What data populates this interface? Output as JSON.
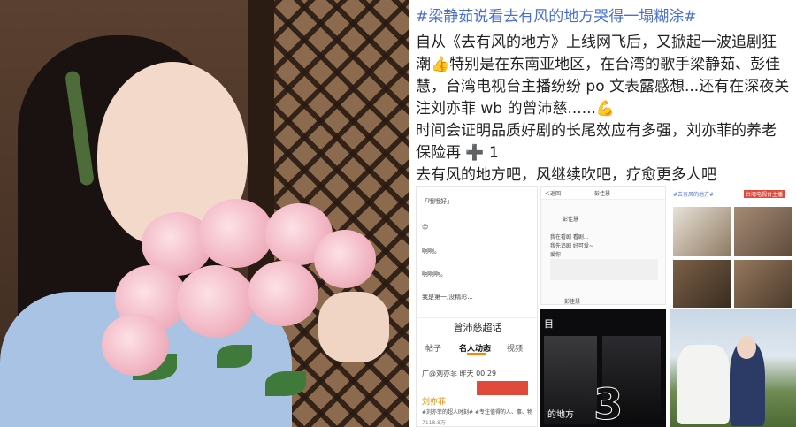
{
  "post": {
    "hashtag": "#梁静茹说看去有风的地方哭得一塌糊涂#",
    "lines": [
      "自从《去有风的地方》上线网飞后，又掀起一波追剧狂",
      "潮👍特别是在东南亚地区，在台湾的歌手梁静茹、彭佳",
      "慧，台湾电视台主播纷纷 po 文表露感想...还有在深夜关",
      "注刘亦菲 wb 的曾沛慈......💪",
      "时间会证明品质好剧的长尾效应有多强，刘亦菲的养老",
      "保险再 ➕ 1",
      "去有风的地方吧，风继续吹吧，疗愈更多人吧"
    ]
  },
  "screenshot_left": {
    "lines": [
      "「哦哦好」",
      "😊",
      "啊啊。",
      "啊啊啊。",
      "我是第一,没精彩..."
    ],
    "header": "曾沛慈超话",
    "tabs": [
      "帖子",
      "名人动态",
      "视频"
    ],
    "meta": "广@刘亦菲 昨天 00:29",
    "name": "刘亦菲",
    "desc": "#刘亦菲的超人时刻# #专注值得的人、事、物",
    "stat": "7118.8万"
  },
  "screenshot_middle": {
    "back": "＜返回",
    "title": "彭佳慧",
    "name1": "彭佳慧",
    "text1": "我在看剧 看剧...",
    "text2": "我先追剧 好可爱~",
    "text3": "爱你",
    "name2": "彭佳慧"
  },
  "screenshot_right_top": {
    "caption": "#去有风的地方#",
    "badge": "台湾电视台主播"
  },
  "screenshot_poster": {
    "label": "目",
    "title": "的地方",
    "number": "3"
  }
}
